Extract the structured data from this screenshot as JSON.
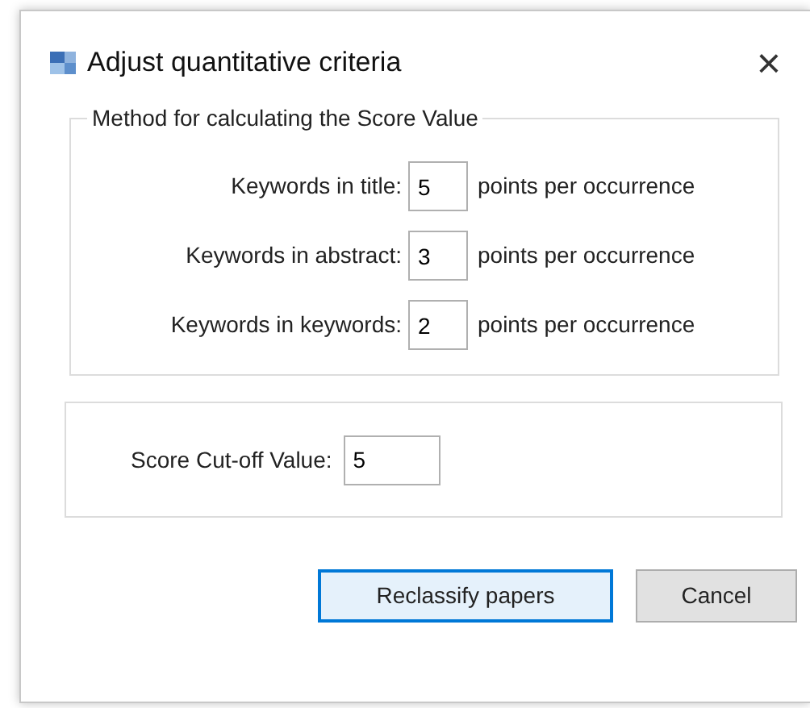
{
  "window": {
    "title": "Adjust quantitative criteria",
    "close": "×"
  },
  "method_group": {
    "legend": "Method for calculating the Score Value",
    "rows": [
      {
        "label": "Keywords in title:",
        "value": "5",
        "unit": "points per occurrence"
      },
      {
        "label": "Keywords in abstract:",
        "value": "3",
        "unit": "points per occurrence"
      },
      {
        "label": "Keywords in keywords:",
        "value": "2",
        "unit": "points per occurrence"
      }
    ]
  },
  "cutoff": {
    "label": "Score Cut-off Value:",
    "value": "5"
  },
  "buttons": [
    {
      "label": "Reclassify papers",
      "default": true
    },
    {
      "label": "Cancel",
      "default": false
    }
  ]
}
